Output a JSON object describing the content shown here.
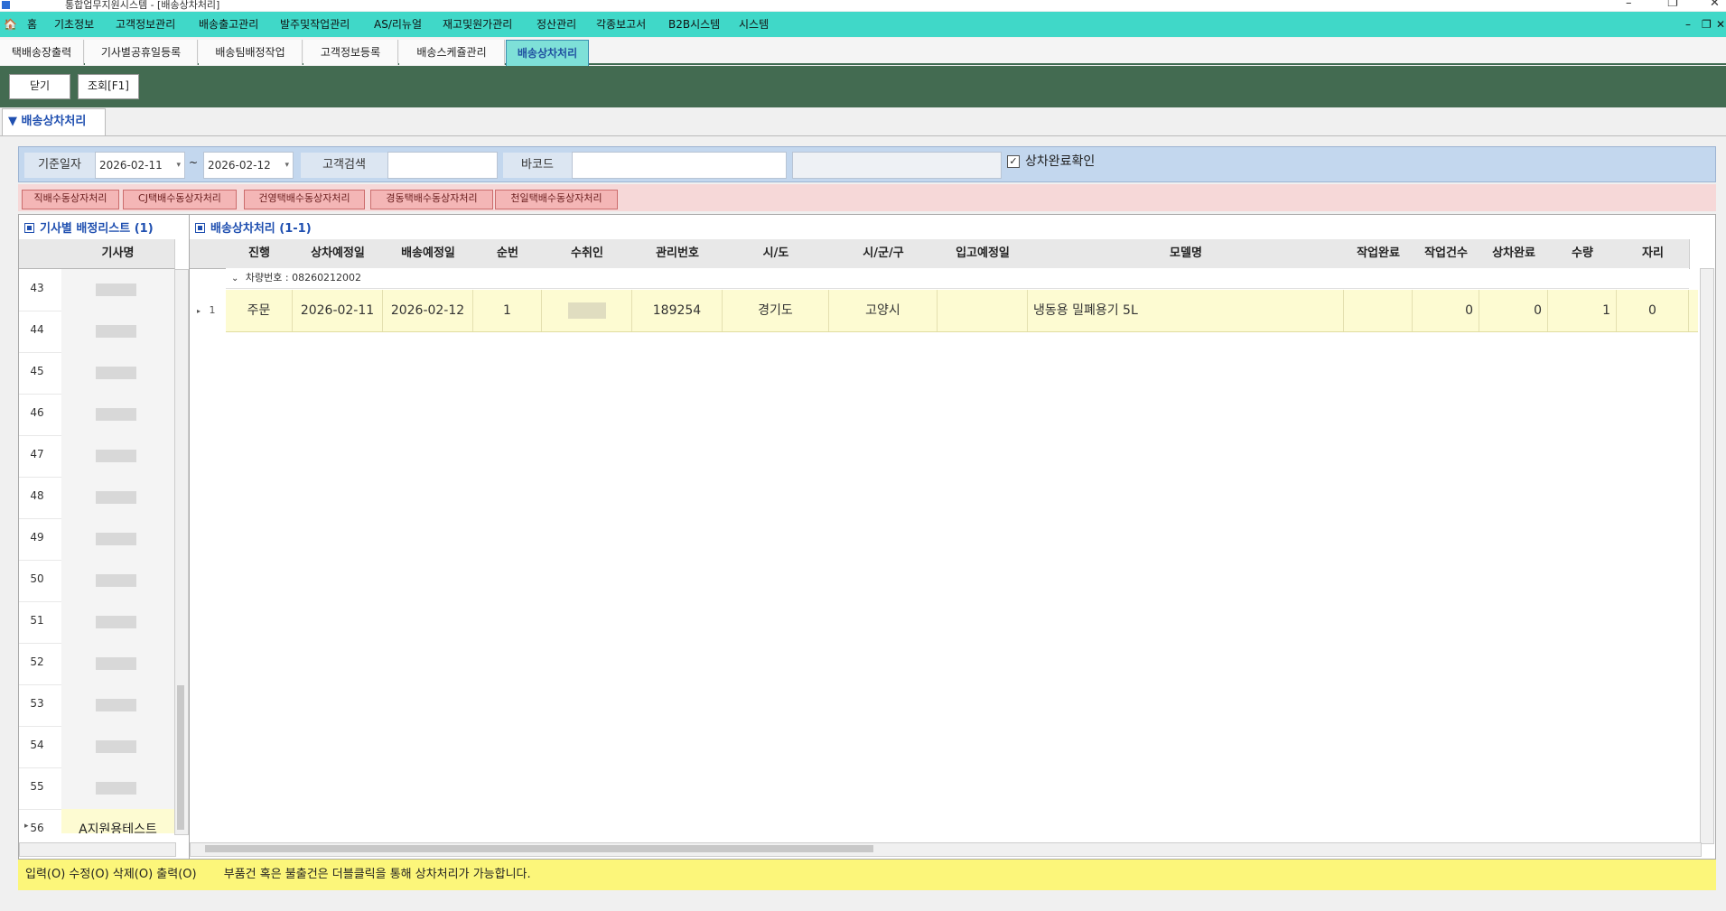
{
  "window": {
    "title": "통합업무지원시스템 - [배송상차처리]"
  },
  "menu": [
    "홈",
    "기초정보",
    "고객정보관리",
    "배송출고관리",
    "발주및작업관리",
    "AS/리뉴얼",
    "재고및원가관리",
    "정산관리",
    "각종보고서",
    "B2B시스템",
    "시스템"
  ],
  "doc_tabs": [
    "택배송장출력",
    "기사별공휴일등록",
    "배송팀배정작업",
    "고객정보등록",
    "배송스케쥴관리",
    "배송상차처리"
  ],
  "toolbar": {
    "close_label": "닫기",
    "search_label": "조회[F1]"
  },
  "section_title": "▼ 배송상차처리",
  "filter": {
    "date_label": "기준일자",
    "date_from": "2026-02-11",
    "date_sep": "~",
    "date_to": "2026-02-12",
    "customer_label": "고객검색",
    "customer_value": "",
    "barcode_label": "바코드",
    "barcode_value": "",
    "confirm_label": "상차완료확인",
    "confirm_checked": true
  },
  "actions": [
    "직배수동상자처리",
    "CJ택배수동상자처리",
    "건영택배수동상자처리",
    "경동택배수동상자처리",
    "천일택배수동상자처리"
  ],
  "left_panel": {
    "title": "기사별 배정리스트 (1)",
    "column": "기사명",
    "rows": [
      {
        "num": "43",
        "name": ""
      },
      {
        "num": "44",
        "name": ""
      },
      {
        "num": "45",
        "name": ""
      },
      {
        "num": "46",
        "name": ""
      },
      {
        "num": "47",
        "name": ""
      },
      {
        "num": "48",
        "name": ""
      },
      {
        "num": "49",
        "name": ""
      },
      {
        "num": "50",
        "name": ""
      },
      {
        "num": "51",
        "name": ""
      },
      {
        "num": "52",
        "name": ""
      },
      {
        "num": "53",
        "name": ""
      },
      {
        "num": "54",
        "name": ""
      },
      {
        "num": "55",
        "name": ""
      },
      {
        "num": "56",
        "name": "A지원용테스트"
      }
    ]
  },
  "right_panel": {
    "title": "배송상차처리 (1-1)",
    "columns": [
      "진행",
      "상차예정일",
      "배송예정일",
      "순번",
      "수취인",
      "관리번호",
      "시/도",
      "시/군/구",
      "입고예정일",
      "모델명",
      "작업완료",
      "작업건수",
      "상차완료",
      "수량",
      "자리"
    ],
    "group_label": "차량번호 : 08260212002",
    "rows": [
      {
        "row_no": "1",
        "status": "주문",
        "load_date": "2026-02-11",
        "ship_date": "2026-02-12",
        "seq": "1",
        "receiver": "",
        "mgmt_no": "189254",
        "sido": "경기도",
        "sigungu": "고양시",
        "in_date": "",
        "model": "냉동용 밀폐용기 5L",
        "done": "",
        "work_cnt": "0",
        "load_done": "0",
        "qty": "1",
        "seat": "0"
      }
    ]
  },
  "status": {
    "left": "입력(O) 수정(O) 삭제(O) 출력(O)",
    "message": "부품건 혹은 불출건은 더블클릭을 통해 상차처리가 가능합니다."
  }
}
